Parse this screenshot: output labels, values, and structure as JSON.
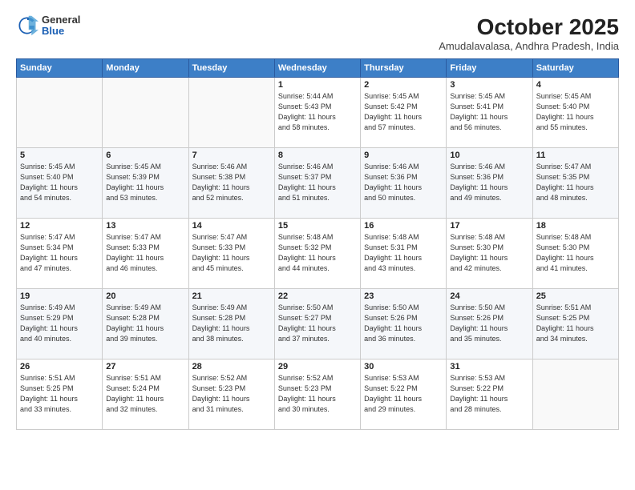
{
  "header": {
    "logo_general": "General",
    "logo_blue": "Blue",
    "month_title": "October 2025",
    "location": "Amudalavalasa, Andhra Pradesh, India"
  },
  "weekdays": [
    "Sunday",
    "Monday",
    "Tuesday",
    "Wednesday",
    "Thursday",
    "Friday",
    "Saturday"
  ],
  "weeks": [
    [
      {
        "day": "",
        "info": ""
      },
      {
        "day": "",
        "info": ""
      },
      {
        "day": "",
        "info": ""
      },
      {
        "day": "1",
        "info": "Sunrise: 5:44 AM\nSunset: 5:43 PM\nDaylight: 11 hours\nand 58 minutes."
      },
      {
        "day": "2",
        "info": "Sunrise: 5:45 AM\nSunset: 5:42 PM\nDaylight: 11 hours\nand 57 minutes."
      },
      {
        "day": "3",
        "info": "Sunrise: 5:45 AM\nSunset: 5:41 PM\nDaylight: 11 hours\nand 56 minutes."
      },
      {
        "day": "4",
        "info": "Sunrise: 5:45 AM\nSunset: 5:40 PM\nDaylight: 11 hours\nand 55 minutes."
      }
    ],
    [
      {
        "day": "5",
        "info": "Sunrise: 5:45 AM\nSunset: 5:40 PM\nDaylight: 11 hours\nand 54 minutes."
      },
      {
        "day": "6",
        "info": "Sunrise: 5:45 AM\nSunset: 5:39 PM\nDaylight: 11 hours\nand 53 minutes."
      },
      {
        "day": "7",
        "info": "Sunrise: 5:46 AM\nSunset: 5:38 PM\nDaylight: 11 hours\nand 52 minutes."
      },
      {
        "day": "8",
        "info": "Sunrise: 5:46 AM\nSunset: 5:37 PM\nDaylight: 11 hours\nand 51 minutes."
      },
      {
        "day": "9",
        "info": "Sunrise: 5:46 AM\nSunset: 5:36 PM\nDaylight: 11 hours\nand 50 minutes."
      },
      {
        "day": "10",
        "info": "Sunrise: 5:46 AM\nSunset: 5:36 PM\nDaylight: 11 hours\nand 49 minutes."
      },
      {
        "day": "11",
        "info": "Sunrise: 5:47 AM\nSunset: 5:35 PM\nDaylight: 11 hours\nand 48 minutes."
      }
    ],
    [
      {
        "day": "12",
        "info": "Sunrise: 5:47 AM\nSunset: 5:34 PM\nDaylight: 11 hours\nand 47 minutes."
      },
      {
        "day": "13",
        "info": "Sunrise: 5:47 AM\nSunset: 5:33 PM\nDaylight: 11 hours\nand 46 minutes."
      },
      {
        "day": "14",
        "info": "Sunrise: 5:47 AM\nSunset: 5:33 PM\nDaylight: 11 hours\nand 45 minutes."
      },
      {
        "day": "15",
        "info": "Sunrise: 5:48 AM\nSunset: 5:32 PM\nDaylight: 11 hours\nand 44 minutes."
      },
      {
        "day": "16",
        "info": "Sunrise: 5:48 AM\nSunset: 5:31 PM\nDaylight: 11 hours\nand 43 minutes."
      },
      {
        "day": "17",
        "info": "Sunrise: 5:48 AM\nSunset: 5:30 PM\nDaylight: 11 hours\nand 42 minutes."
      },
      {
        "day": "18",
        "info": "Sunrise: 5:48 AM\nSunset: 5:30 PM\nDaylight: 11 hours\nand 41 minutes."
      }
    ],
    [
      {
        "day": "19",
        "info": "Sunrise: 5:49 AM\nSunset: 5:29 PM\nDaylight: 11 hours\nand 40 minutes."
      },
      {
        "day": "20",
        "info": "Sunrise: 5:49 AM\nSunset: 5:28 PM\nDaylight: 11 hours\nand 39 minutes."
      },
      {
        "day": "21",
        "info": "Sunrise: 5:49 AM\nSunset: 5:28 PM\nDaylight: 11 hours\nand 38 minutes."
      },
      {
        "day": "22",
        "info": "Sunrise: 5:50 AM\nSunset: 5:27 PM\nDaylight: 11 hours\nand 37 minutes."
      },
      {
        "day": "23",
        "info": "Sunrise: 5:50 AM\nSunset: 5:26 PM\nDaylight: 11 hours\nand 36 minutes."
      },
      {
        "day": "24",
        "info": "Sunrise: 5:50 AM\nSunset: 5:26 PM\nDaylight: 11 hours\nand 35 minutes."
      },
      {
        "day": "25",
        "info": "Sunrise: 5:51 AM\nSunset: 5:25 PM\nDaylight: 11 hours\nand 34 minutes."
      }
    ],
    [
      {
        "day": "26",
        "info": "Sunrise: 5:51 AM\nSunset: 5:25 PM\nDaylight: 11 hours\nand 33 minutes."
      },
      {
        "day": "27",
        "info": "Sunrise: 5:51 AM\nSunset: 5:24 PM\nDaylight: 11 hours\nand 32 minutes."
      },
      {
        "day": "28",
        "info": "Sunrise: 5:52 AM\nSunset: 5:23 PM\nDaylight: 11 hours\nand 31 minutes."
      },
      {
        "day": "29",
        "info": "Sunrise: 5:52 AM\nSunset: 5:23 PM\nDaylight: 11 hours\nand 30 minutes."
      },
      {
        "day": "30",
        "info": "Sunrise: 5:53 AM\nSunset: 5:22 PM\nDaylight: 11 hours\nand 29 minutes."
      },
      {
        "day": "31",
        "info": "Sunrise: 5:53 AM\nSunset: 5:22 PM\nDaylight: 11 hours\nand 28 minutes."
      },
      {
        "day": "",
        "info": ""
      }
    ]
  ]
}
